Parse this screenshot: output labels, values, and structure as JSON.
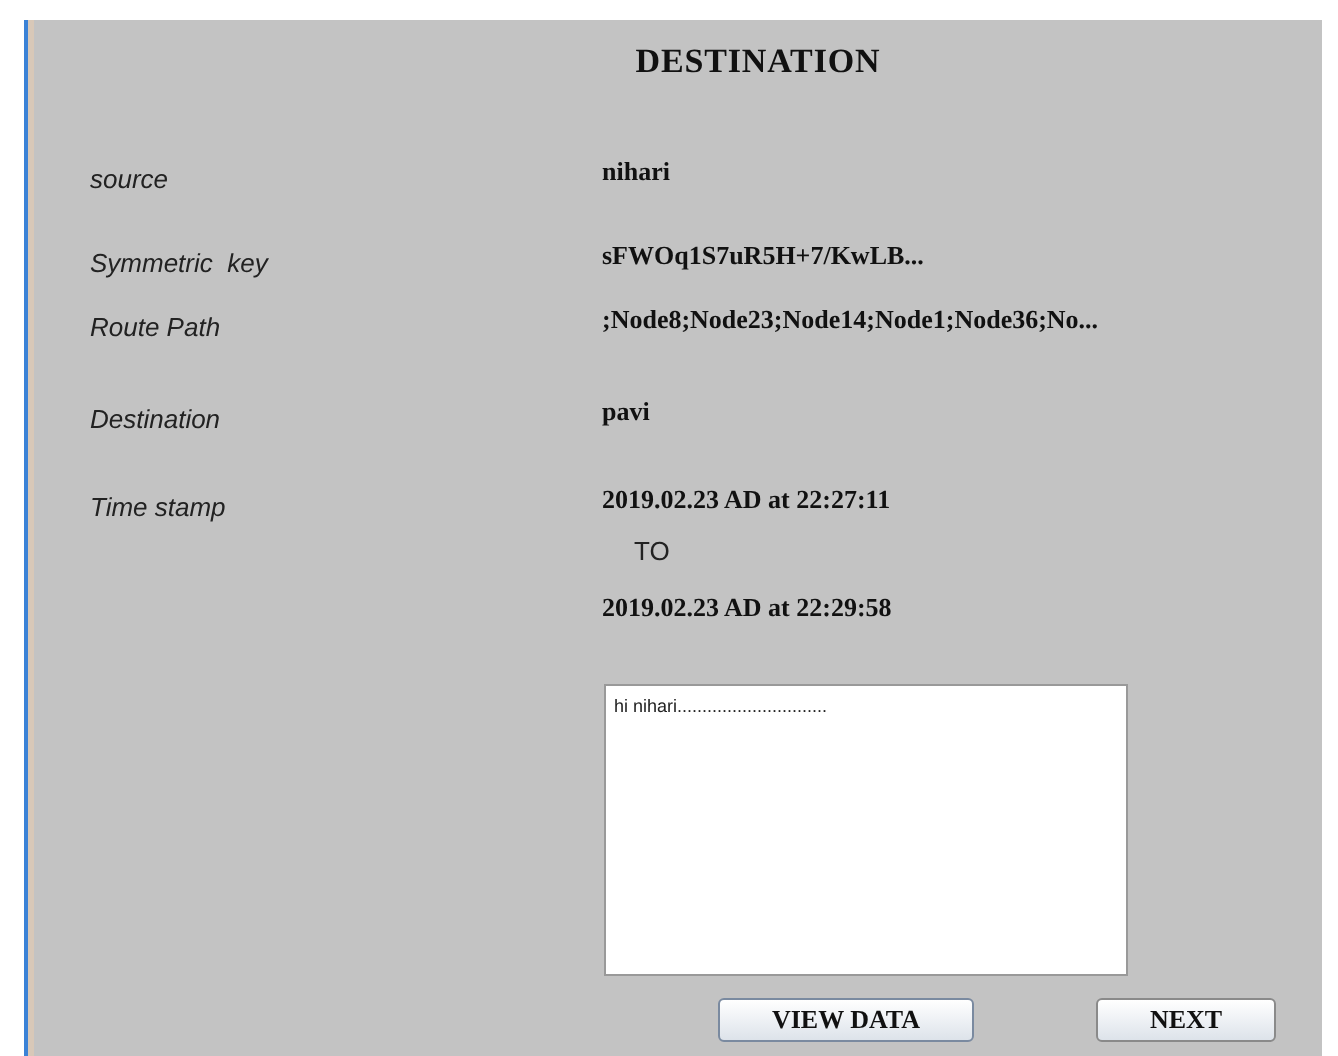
{
  "title": "DESTINATION",
  "fields": [
    {
      "label": "source",
      "value": "nihari"
    },
    {
      "label": "Symmetric  key",
      "value": "sFWOq1S7uR5H+7/KwLB..."
    },
    {
      "label": "Route Path",
      "value": ";Node8;Node23;Node14;Node1;Node36;No..."
    },
    {
      "label": "Destination",
      "value": "pavi"
    },
    {
      "label": "Time stamp",
      "value": "2019.02.23 AD at 22:27:11"
    }
  ],
  "to_label": "TO",
  "end_time": "2019.02.23 AD at 22:29:58",
  "message": "hi nihari..............................",
  "buttons": [
    "VIEW DATA",
    "NEXT"
  ]
}
